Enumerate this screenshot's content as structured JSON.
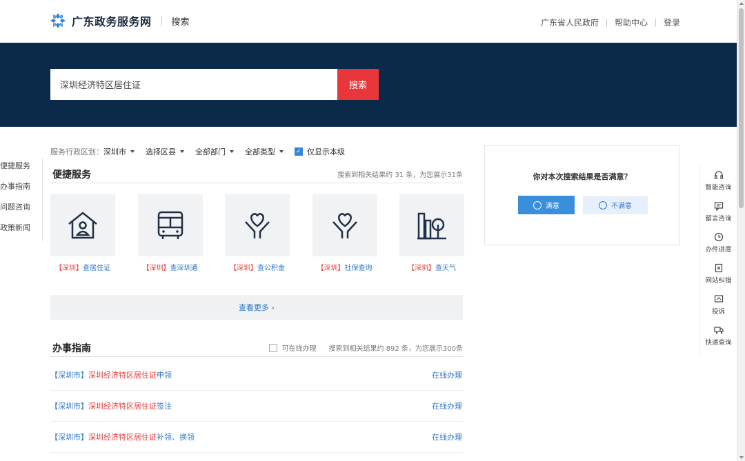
{
  "header": {
    "site_name": "广东政务服务网",
    "sub_title": "搜索",
    "links": [
      "广东省人民政府",
      "帮助中心",
      "登录"
    ]
  },
  "search": {
    "query": "深圳经济特区居住证",
    "button": "搜索"
  },
  "filters": {
    "region_label": "服务行政区划：",
    "city": "深圳市",
    "district": "选择区县",
    "department": "全部部门",
    "type": "全部类型",
    "only_level_label": "仅显示本级",
    "only_level_checked": true
  },
  "sidenav": [
    "便捷服务",
    "办事指南",
    "问题咨询",
    "政策新闻"
  ],
  "quick_services": {
    "title": "便捷服务",
    "info": "搜索到相关结果约 31 条，为您展示31条",
    "items": [
      {
        "region": "【深圳】",
        "name": "查居住证",
        "icon": "house-person-icon"
      },
      {
        "region": "【深圳】",
        "name": "查深圳通",
        "icon": "bus-icon"
      },
      {
        "region": "【深圳】",
        "name": "查公积金",
        "icon": "heart-hands-icon"
      },
      {
        "region": "【深圳】",
        "name": "社保查询",
        "icon": "heart-hands-icon"
      },
      {
        "region": "【深圳】",
        "name": "查天气",
        "icon": "city-tree-icon"
      }
    ],
    "more": "查看更多 ›"
  },
  "guide": {
    "title": "办事指南",
    "online_filter_label": "可在线办理",
    "info": "搜索到相关结果约 892 条，为您展示300条",
    "rows": [
      {
        "region": "【深圳市】",
        "highlight": "深圳经济特区居住证",
        "rest": "申领",
        "action": "在线办理"
      },
      {
        "region": "【深圳市】",
        "highlight": "深圳经济特区居住证",
        "rest": "签注",
        "action": "在线办理"
      },
      {
        "region": "【深圳市】",
        "highlight": "深圳经济特区居住证",
        "rest": "补领、换领",
        "action": "在线办理"
      }
    ]
  },
  "feedback": {
    "question": "你对本次搜索结果是否满意？",
    "yes": "满意",
    "no": "不满意"
  },
  "rail": [
    {
      "label": "智能咨询",
      "icon": "headset-icon"
    },
    {
      "label": "留言咨询",
      "icon": "message-icon"
    },
    {
      "label": "办件进度",
      "icon": "clock-icon"
    },
    {
      "label": "网站纠错",
      "icon": "error-doc-icon"
    },
    {
      "label": "投诉",
      "icon": "complaint-icon"
    },
    {
      "label": "快递查询",
      "icon": "truck-icon"
    }
  ],
  "colors": {
    "banner": "#0b2a4a",
    "search_button": "#e9363b",
    "link_blue": "#2f77c4",
    "highlight_red": "#e33a3a"
  }
}
